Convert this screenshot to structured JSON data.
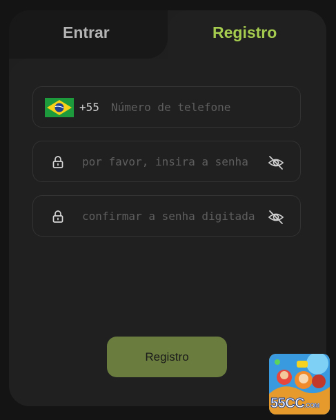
{
  "tabs": {
    "login_label": "Entrar",
    "register_label": "Registro"
  },
  "phone": {
    "country_prefix": "+55",
    "placeholder": "Número de telefone",
    "flag": "brazil-flag"
  },
  "password": {
    "placeholder": "por favor, insira a senha",
    "toggle_icon": "eye-off-icon"
  },
  "confirm": {
    "placeholder": "confirmar a senha digitada",
    "toggle_icon": "eye-off-icon"
  },
  "submit": {
    "label": "Registro"
  },
  "promo": {
    "brand": "55CC",
    "domain": ".COM"
  },
  "colors": {
    "accent": "#a5cc4e",
    "button": "#6a7d3e",
    "background": "#141414",
    "card": "#202020"
  }
}
